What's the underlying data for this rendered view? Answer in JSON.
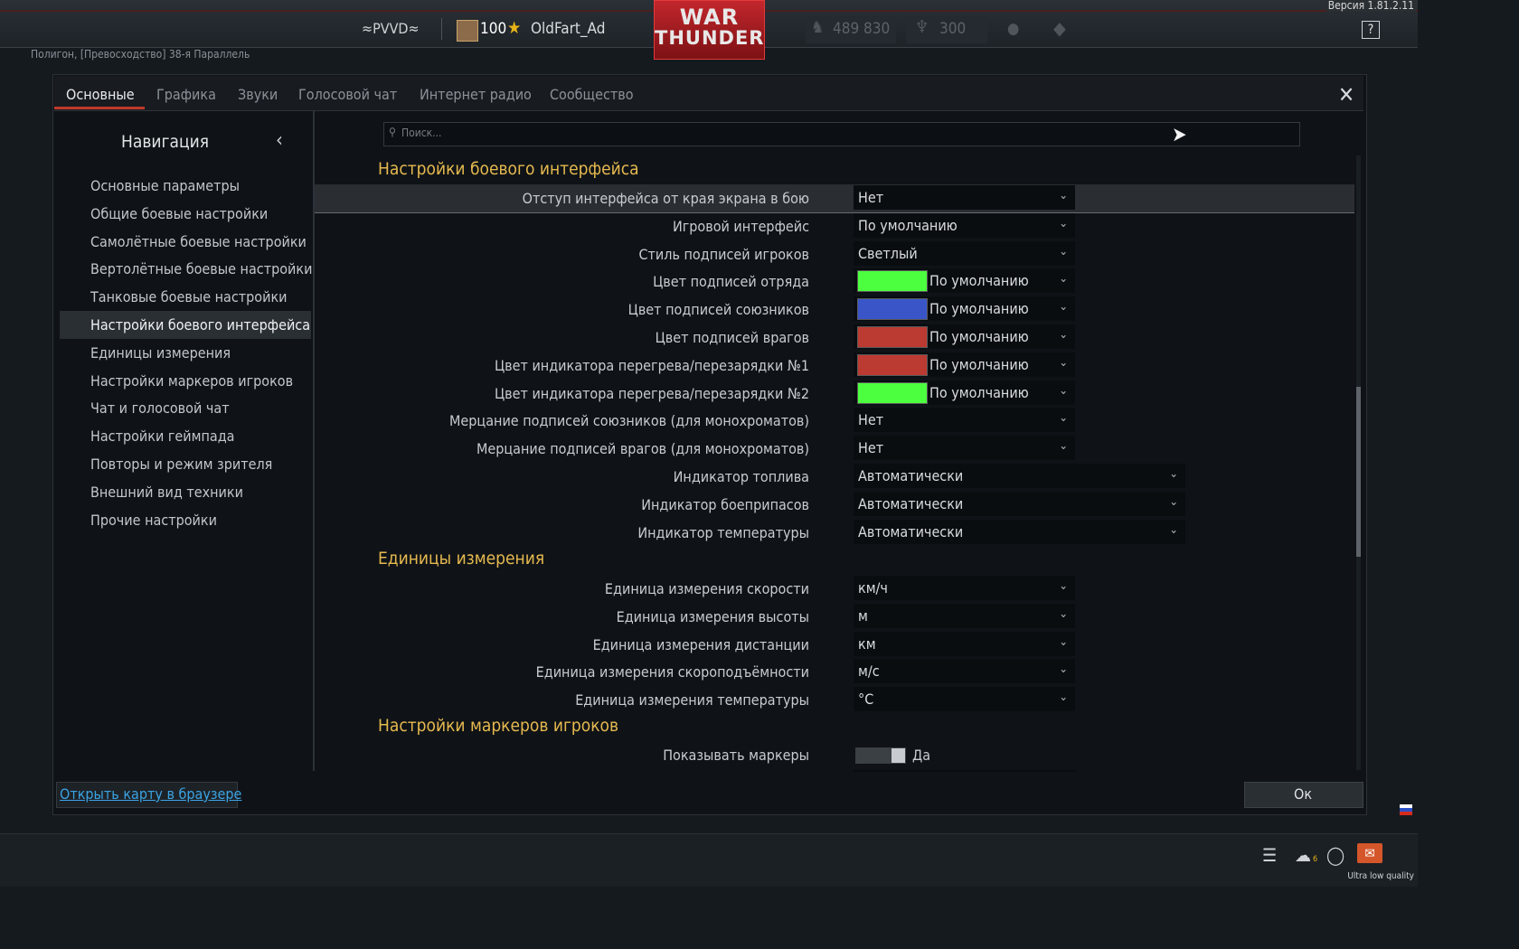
{
  "version": "Версия 1.81.2.11",
  "topbar": {
    "squad": "≈PVVD≈",
    "level": "100",
    "nickname": "OldFart_Ad",
    "logo_line1": "WAR",
    "logo_line2": "THUNDER",
    "lions": "489 830",
    "eagles": "300",
    "help": "?"
  },
  "map_name": "Полигон, [Превосходство] 38-я Параллель",
  "tabs": [
    "Основные",
    "Графика",
    "Звуки",
    "Голосовой чат",
    "Интернет радио",
    "Сообщество"
  ],
  "close": "✕",
  "nav": {
    "title": "Навигация",
    "items": [
      "Основные параметры",
      "Общие боевые настройки",
      "Самолётные боевые настройки",
      "Вертолётные боевые настройки",
      "Танковые боевые настройки",
      "Настройки боевого интерфейса",
      "Единицы измерения",
      "Настройки маркеров игроков",
      "Чат и голосовой чат",
      "Настройки геймпада",
      "Повторы и режим зрителя",
      "Внешний вид техники",
      "Прочие настройки"
    ],
    "selected_index": 5
  },
  "search": {
    "placeholder": "Поиск..."
  },
  "sections": {
    "hud": "Настройки боевого интерфейса",
    "units": "Единицы измерения",
    "markers": "Настройки маркеров игроков"
  },
  "hud_rows": [
    {
      "label": "Отступ интерфейса от края экрана в бою",
      "value": "Нет"
    },
    {
      "label": "Игровой интерфейс",
      "value": "По умолчанию"
    },
    {
      "label": "Стиль подписей игроков",
      "value": "Светлый"
    },
    {
      "label": "Цвет подписей отряда",
      "value": "По умолчанию",
      "color": "#4cff3f"
    },
    {
      "label": "Цвет подписей союзников",
      "value": "По умолчанию",
      "color": "#3a55c8"
    },
    {
      "label": "Цвет подписей врагов",
      "value": "По умолчанию",
      "color": "#bb3a32"
    },
    {
      "label": "Цвет индикатора перегрева/перезарядки №1",
      "value": "По умолчанию",
      "color": "#bb3a32"
    },
    {
      "label": "Цвет индикатора перегрева/перезарядки №2",
      "value": "По умолчанию",
      "color": "#4cff3f"
    },
    {
      "label": "Мерцание подписей союзников (для монохроматов)",
      "value": "Нет"
    },
    {
      "label": "Мерцание подписей врагов (для монохроматов)",
      "value": "Нет"
    },
    {
      "label": "Индикатор топлива",
      "value": "Автоматически"
    },
    {
      "label": "Индикатор боеприпасов",
      "value": "Автоматически"
    },
    {
      "label": "Индикатор температуры",
      "value": "Автоматически"
    }
  ],
  "unit_rows": [
    {
      "label": "Единица измерения скорости",
      "value": "км/ч"
    },
    {
      "label": "Единица измерения высоты",
      "value": "м"
    },
    {
      "label": "Единица измерения дистанции",
      "value": "км"
    },
    {
      "label": "Единица измерения скороподъёмности",
      "value": "м/с"
    },
    {
      "label": "Единица измерения температуры",
      "value": "°C"
    }
  ],
  "marker_rows": [
    {
      "label": "Показывать маркеры",
      "value": "Да"
    }
  ],
  "footer": {
    "open_map": "Открыть карту в браузере",
    "ok": "Ок"
  },
  "bottombar": {
    "squad_count": "6",
    "quality": "Ultra low quality"
  },
  "colors": {
    "accent_section": "#e6b94f",
    "tab_underline": "#c0392b",
    "link": "#3aa3e3"
  }
}
